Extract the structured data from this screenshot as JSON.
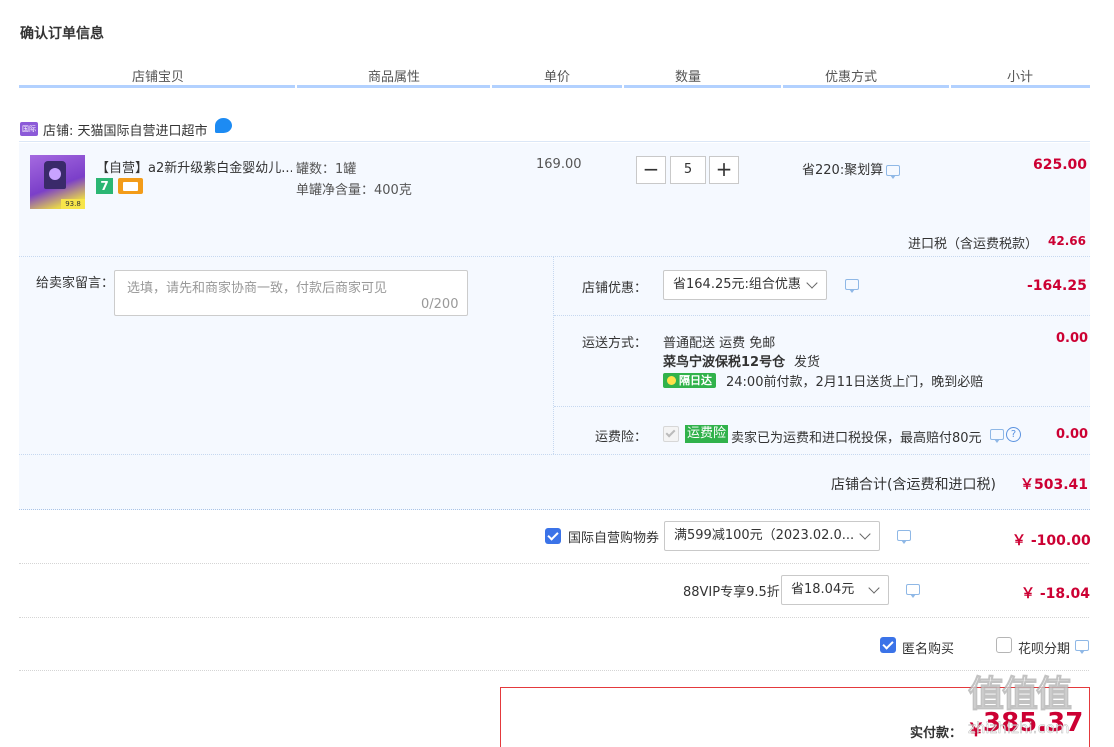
{
  "page_title": "确认订单信息",
  "columns": [
    "店铺宝贝",
    "商品属性",
    "单价",
    "数量",
    "优惠方式",
    "小计"
  ],
  "shop": {
    "name": "店铺: 天猫国际自营进口超市",
    "badge": "国际"
  },
  "item": {
    "thumb_score": "93.8",
    "title": "【自营】a2新升级紫白金婴幼儿...",
    "attr_1": "罐数：1罐",
    "attr_2": "单罐净含量：400克",
    "price": "169.00",
    "qty": "5",
    "promo": "省220:聚划算",
    "subtotal": "625.00",
    "badge_7": "7"
  },
  "tax": {
    "label": "进口税（含运费税款）",
    "value": "42.66"
  },
  "message": {
    "label": "给卖家留言：",
    "placeholder": "选填，请先和商家协商一致，付款后商家可见",
    "counter": "0/200"
  },
  "shop_discount": {
    "label": "店铺优惠：",
    "selected": "省164.25元:组合优惠",
    "value": "-164.25"
  },
  "shipping": {
    "label": "运送方式：",
    "line1": "普通配送 运费 免邮",
    "warehouse": "菜鸟宁波保税12号仓",
    "warehouse_suffix": "发货",
    "tag": "隔日达",
    "line3": "24:00前付款，2月11日送货上门，晚到必赔",
    "value": "0.00"
  },
  "insurance": {
    "label": "运费险：",
    "tag": "运费险",
    "text": "卖家已为运费和进口税投保，最高赔付80元",
    "value": "0.00",
    "help": "?"
  },
  "shop_total": {
    "label": "店铺合计(含运费和进口税)",
    "value": "￥503.41"
  },
  "coupon": {
    "label": "国际自营购物券",
    "selected": "满599减100元（2023.02.0...",
    "value": "￥ -100.00"
  },
  "vip": {
    "label": "88VIP专享9.5折",
    "selected": "省18.04元",
    "value": "￥ -18.04"
  },
  "options": {
    "anonymous": "匿名购买",
    "huabei": "花呗分期"
  },
  "payment": {
    "label": "实付款：",
    "currency": "￥",
    "value": "385.37"
  },
  "watermark": {
    "main": "值值值",
    "sub": "zhizhizhi.com"
  },
  "colors": {
    "accent": "#3b73e8",
    "price_red": "#cc0033",
    "header_line": "#b2d1ff",
    "panel_bg": "#f5f9ff",
    "green_tag": "#31b24b"
  }
}
